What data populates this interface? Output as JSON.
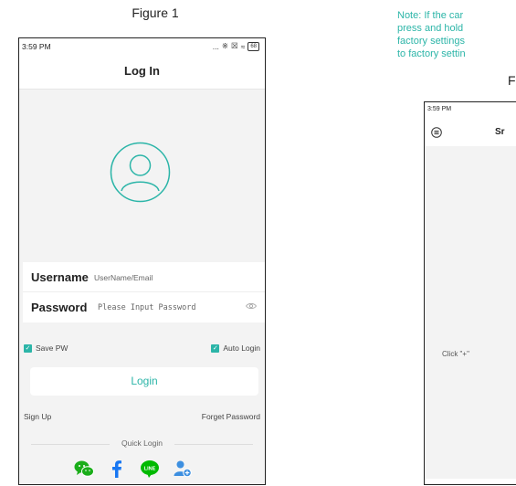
{
  "figure_caption": "Figure 1",
  "status": {
    "time": "3:59 PM",
    "signal": "...",
    "battery": "68"
  },
  "header": {
    "title": "Log In"
  },
  "form": {
    "username_label": "Username",
    "username_value": "UserName/Email",
    "password_label": "Password",
    "password_placeholder": "Please Input Password"
  },
  "options": {
    "save_pw": "Save PW",
    "auto_login": "Auto Login"
  },
  "login_button": "Login",
  "links": {
    "sign_up": "Sign Up",
    "forget_password": "Forget Password"
  },
  "quick_login": {
    "label": "Quick Login",
    "providers": [
      "wechat-icon",
      "facebook-icon",
      "line-icon",
      "contacts-icon"
    ]
  },
  "colors": {
    "accent": "#2cb5a8",
    "wechat": "#1aad19",
    "facebook": "#1877f2",
    "line": "#00b900",
    "contacts": "#3d8fe0"
  },
  "right": {
    "note_lines": [
      "Note: If the car",
      "press and hold",
      "factory settings",
      "to factory settin"
    ],
    "caption": "F",
    "phone": {
      "time": "3:59 PM",
      "header_title": "Sr",
      "hint": "Click \"+\""
    }
  }
}
